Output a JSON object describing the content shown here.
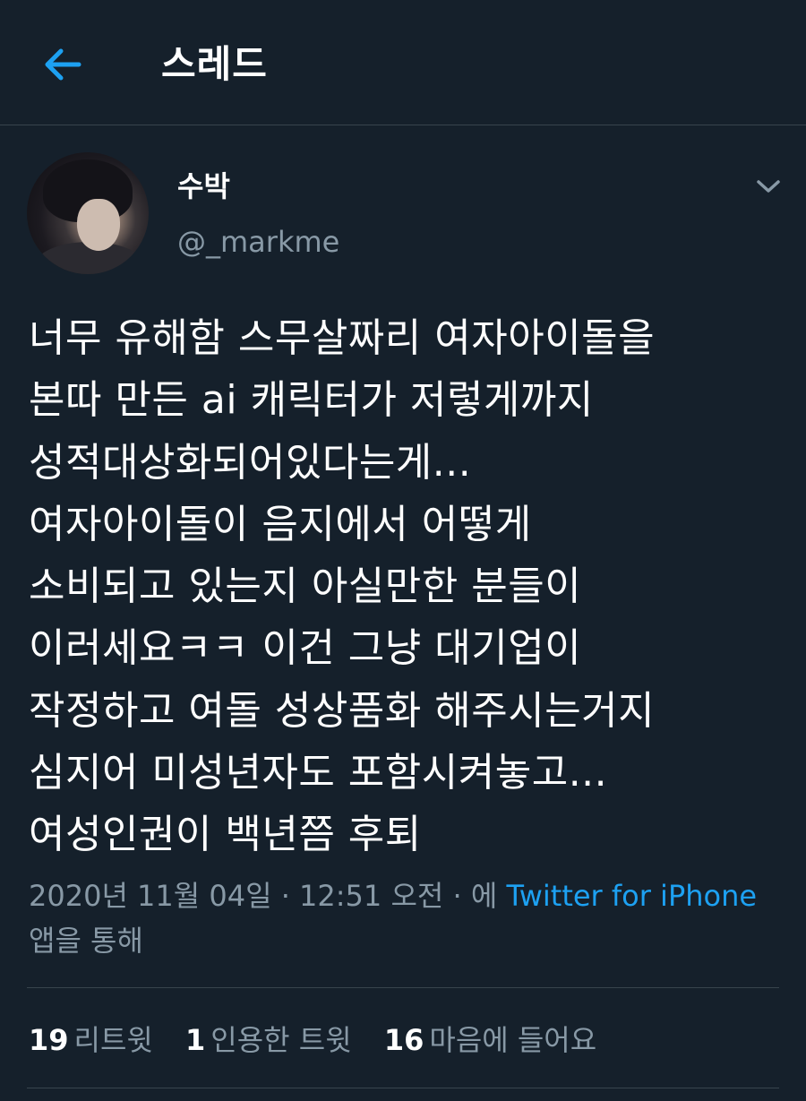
{
  "header": {
    "title": "스레드",
    "back_icon": "arrow-left-icon"
  },
  "tweet": {
    "display_name": "수박",
    "handle": "@_markme",
    "menu_icon": "chevron-down-icon",
    "text_lines": [
      "너무 유해함 스무살짜리 여자아이돌을",
      "본따 만든 ai 캐릭터가 저렇게까지",
      "성적대상화되어있다는게...",
      "여자아이돌이 음지에서 어떻게",
      "소비되고 있는지 아실만한 분들이",
      "이러세요ㅋㅋ 이건 그냥 대기업이",
      "작정하고 여돌 성상품화 해주시는거지",
      "심지어 미성년자도 포함시켜놓고...",
      "여성인권이 백년쯤 후퇴"
    ],
    "timestamp": "2020년 11월 04일 · 12:51 오전 · 에 ",
    "source_link": "Twitter for iPhone",
    "source_suffix": " 앱을 통해"
  },
  "stats": {
    "retweets_count": "19",
    "retweets_label": "리트윗",
    "quotes_count": "1",
    "quotes_label": "인용한 트윗",
    "likes_count": "16",
    "likes_label": "마음에 들어요"
  },
  "colors": {
    "background": "#15202b",
    "accent": "#1da1f2",
    "secondary_text": "#8899a6",
    "divider": "#38444d"
  }
}
